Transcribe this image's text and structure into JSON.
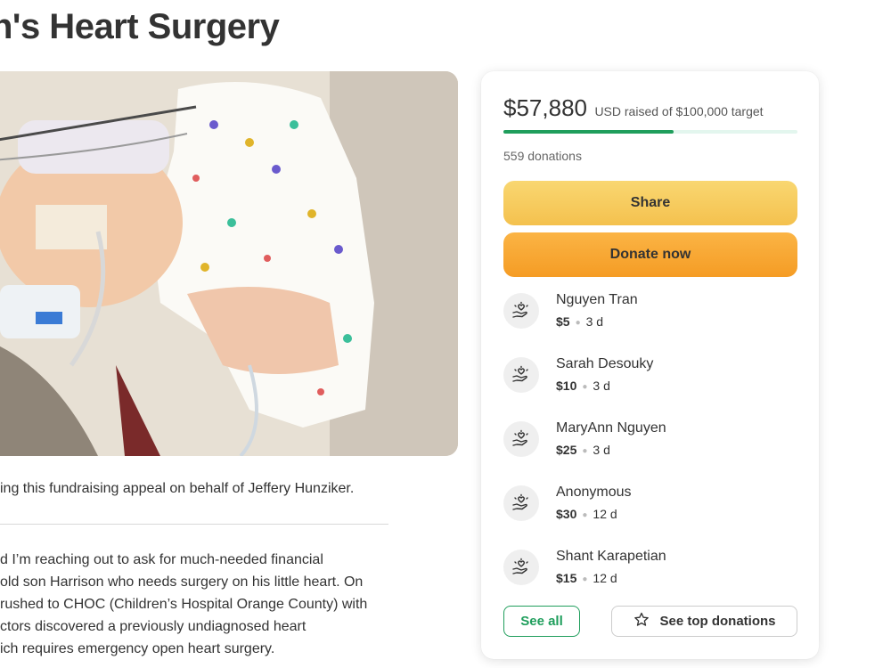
{
  "page": {
    "title": "n's Heart Surgery"
  },
  "hero": {
    "alt": "Photo of infant in hospital"
  },
  "organizer": {
    "text": "ing this fundraising appeal on behalf of Jeffery Hunziker."
  },
  "story": {
    "lines": [
      "d I’m reaching out to ask for much-needed financial",
      "old son Harrison who needs surgery on his little heart. On",
      "rushed to CHOC (Children’s Hospital Orange County) with",
      "ctors discovered a previously undiagnosed heart",
      "ich requires emergency open heart surgery."
    ]
  },
  "donation_panel": {
    "raised_amount": "$57,880",
    "raised_meta": "USD raised of $100,000 target",
    "progress_fraction": 0.5788,
    "donation_count": "559 donations",
    "share_label": "Share",
    "donate_label": "Donate now",
    "see_all_label": "See all",
    "top_donations_label": "See top donations",
    "donors": [
      {
        "name": "Nguyen Tran",
        "amount": "$5",
        "time": "3 d"
      },
      {
        "name": "Sarah Desouky",
        "amount": "$10",
        "time": "3 d"
      },
      {
        "name": "MaryAnn Nguyen",
        "amount": "$25",
        "time": "3 d"
      },
      {
        "name": "Anonymous",
        "amount": "$30",
        "time": "12 d"
      },
      {
        "name": "Shant Karapetian",
        "amount": "$15",
        "time": "12 d"
      }
    ]
  },
  "colors": {
    "accent_green": "#1f9e5c",
    "share_yellow": "#f6cb5c",
    "donate_orange": "#f8a634"
  },
  "icons": {
    "donor_avatar": "heart-in-hand-icon",
    "top_donations": "star-outline-icon"
  }
}
